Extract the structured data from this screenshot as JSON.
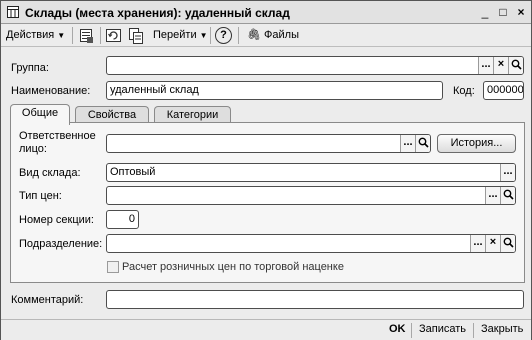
{
  "window": {
    "title": "Склады (места хранения): удаленный склад",
    "minimize": "_",
    "maximize": "□",
    "close": "×"
  },
  "toolbar": {
    "actions_label": "Действия",
    "goto_label": "Перейти",
    "help_icon": "?",
    "files_label": "Файлы"
  },
  "form": {
    "group_label": "Группа:",
    "group_value": "",
    "name_label": "Наименование:",
    "name_value": "удаленный склад",
    "code_label": "Код:",
    "code_value": "000000"
  },
  "tabs": [
    {
      "label": "Общие",
      "active": true
    },
    {
      "label": "Свойства",
      "active": false
    },
    {
      "label": "Категории",
      "active": false
    }
  ],
  "general": {
    "responsible_label_1": "Ответственное",
    "responsible_label_2": "лицо:",
    "responsible_value": "",
    "history_button": "История...",
    "warehouse_type_label": "Вид склада:",
    "warehouse_type_value": "Оптовый",
    "price_type_label": "Тип цен:",
    "price_type_value": "",
    "section_label": "Номер секции:",
    "section_value": "0",
    "department_label": "Подразделение:",
    "department_value": "",
    "retail_checkbox_label": "Расчет розничных цен по торговой наценке",
    "retail_checked": false
  },
  "comment": {
    "label": "Комментарий:",
    "value": ""
  },
  "footer": {
    "ok": "OK",
    "save": "Записать",
    "close": "Закрыть"
  },
  "field_buttons": {
    "select": "...",
    "clear": "×",
    "open": "🔍"
  }
}
